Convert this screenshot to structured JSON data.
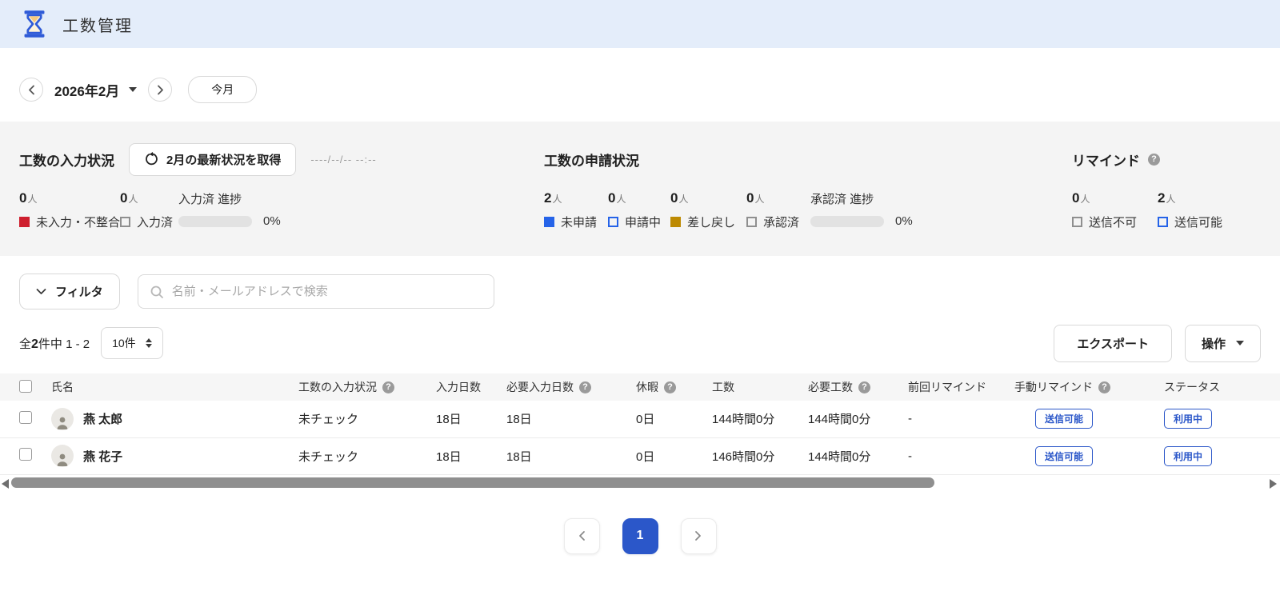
{
  "header": {
    "title": "工数管理"
  },
  "date_nav": {
    "month_label": "2026年2月",
    "today_button": "今月"
  },
  "panel": {
    "input": {
      "title": "工数の入力状況",
      "refresh_button": "2月の最新状況を取得",
      "last_fetched": "----/--/-- --:--",
      "stat1": {
        "count": "0",
        "unit": "人",
        "label": "未入力・不整合",
        "swatch": "red-filled"
      },
      "stat2": {
        "count": "0",
        "unit": "人",
        "label": "入力済",
        "swatch": "gray-outline"
      },
      "progress_label": "入力済 進捗",
      "progress_percent": "0%",
      "progress_value": 0
    },
    "request": {
      "title": "工数の申請状況",
      "stat1": {
        "count": "2",
        "unit": "人",
        "label": "未申請",
        "swatch": "blue-filled"
      },
      "stat2": {
        "count": "0",
        "unit": "人",
        "label": "申請中",
        "swatch": "blue-outline"
      },
      "stat3": {
        "count": "0",
        "unit": "人",
        "label": "差し戻し",
        "swatch": "gold-filled"
      },
      "stat4": {
        "count": "0",
        "unit": "人",
        "label": "承認済",
        "swatch": "gray-outline"
      },
      "progress_label": "承認済 進捗",
      "progress_percent": "0%",
      "progress_value": 0
    },
    "remind": {
      "title": "リマインド",
      "stat1": {
        "count": "0",
        "unit": "人",
        "label": "送信不可",
        "swatch": "gray-outline"
      },
      "stat2": {
        "count": "2",
        "unit": "人",
        "label": "送信可能",
        "swatch": "blue-outline"
      }
    }
  },
  "filter": {
    "button": "フィルタ",
    "search_placeholder": "名前・メールアドレスで検索"
  },
  "controls": {
    "total_prefix": "全",
    "total_count": "2",
    "total_suffix": "件中 1 - 2",
    "page_size": "10件",
    "export_button": "エクスポート",
    "action_button": "操作"
  },
  "table": {
    "headers": {
      "name": "氏名",
      "input_status": "工数の入力状況",
      "input_days": "入力日数",
      "required_days": "必要入力日数",
      "holiday": "休暇",
      "hours": "工数",
      "required_hours": "必要工数",
      "last_remind": "前回リマインド",
      "manual_remind": "手動リマインド",
      "status": "ステータス"
    },
    "rows": [
      {
        "name": "燕 太郎",
        "input_status": "未チェック",
        "input_days": "18日",
        "required_days": "18日",
        "holiday": "0日",
        "hours": "144時間0分",
        "required_hours": "144時間0分",
        "last_remind": "-",
        "manual_remind": "送信可能",
        "status": "利用中"
      },
      {
        "name": "燕 花子",
        "input_status": "未チェック",
        "input_days": "18日",
        "required_days": "18日",
        "holiday": "0日",
        "hours": "146時間0分",
        "required_hours": "144時間0分",
        "last_remind": "-",
        "manual_remind": "送信可能",
        "status": "利用中"
      }
    ]
  },
  "pagination": {
    "current_page": "1"
  },
  "colors": {
    "header_bg": "#e4edfa",
    "accent_blue": "#2b57c9",
    "legend_red": "#ce1f2e",
    "legend_blue": "#2563e8",
    "legend_gold": "#bd8a02",
    "panel_bg": "#f4f4f4"
  }
}
